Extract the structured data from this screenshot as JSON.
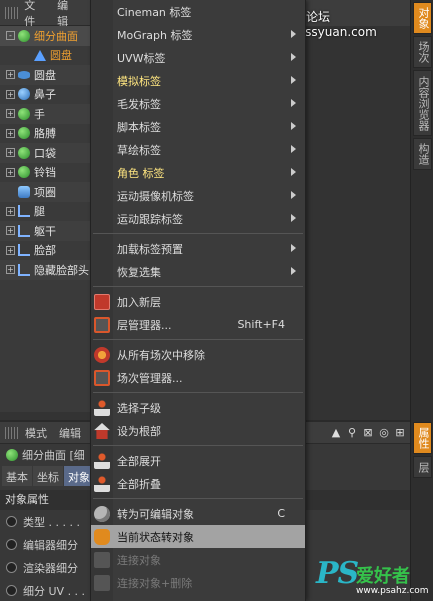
{
  "watermark_text": "思缘设计论坛 www.missyuan.com",
  "object_manager": {
    "menu": [
      "文件",
      "编辑"
    ],
    "items": [
      {
        "label": "细分曲面",
        "indent": 0,
        "icon": "subdivision-icon",
        "color": "orange",
        "expand": "-"
      },
      {
        "label": "圆盘",
        "indent": 1,
        "icon": "polygon-icon",
        "color": "orange",
        "expand": ""
      },
      {
        "label": "圆盘",
        "indent": 0,
        "icon": "disk-icon",
        "color": "normal",
        "expand": "+"
      },
      {
        "label": "鼻子",
        "indent": 0,
        "icon": "sphere-icon",
        "color": "normal",
        "expand": "+"
      },
      {
        "label": "手",
        "indent": 0,
        "icon": "sphere-icon",
        "color": "normal",
        "expand": "+"
      },
      {
        "label": "胳膊",
        "indent": 0,
        "icon": "sphere-icon",
        "color": "normal",
        "expand": "+"
      },
      {
        "label": "口袋",
        "indent": 0,
        "icon": "sphere-icon",
        "color": "normal",
        "expand": "+"
      },
      {
        "label": "铃铛",
        "indent": 0,
        "icon": "subdivision-icon",
        "color": "normal",
        "expand": "+"
      },
      {
        "label": "项圈",
        "indent": 0,
        "icon": "cylinder-icon",
        "color": "normal",
        "expand": ""
      },
      {
        "label": "腿",
        "indent": 0,
        "icon": "bone-icon",
        "color": "normal",
        "expand": "+"
      },
      {
        "label": "躯干",
        "indent": 0,
        "icon": "bone-icon",
        "color": "normal",
        "expand": "+"
      },
      {
        "label": "脸部",
        "indent": 0,
        "icon": "bone-icon",
        "color": "normal",
        "expand": "+"
      },
      {
        "label": "隐藏脸部头",
        "indent": 0,
        "icon": "bone-icon",
        "color": "normal",
        "expand": "+"
      }
    ]
  },
  "attribute_manager": {
    "menu": [
      "模式",
      "编辑"
    ],
    "title": "细分曲面 [细",
    "tabs": [
      "基本",
      "坐标",
      "对象"
    ],
    "active_tab": 2,
    "section": "对象属性",
    "rows": [
      "类型 . . . . .",
      "编辑器细分",
      "渲染器细分",
      "细分 UV . . ."
    ]
  },
  "right_tabs": [
    {
      "label": "对象",
      "active": true
    },
    {
      "label": "场次",
      "active": false
    },
    {
      "label": "内容浏览器",
      "active": false
    },
    {
      "label": "构造",
      "active": false
    },
    {
      "label": "属性",
      "active": true
    },
    {
      "label": "层",
      "active": false
    }
  ],
  "context_menu": {
    "groups": [
      [
        {
          "label": "Cineman 标签",
          "submenu": false,
          "style": "normal"
        },
        {
          "label": "MoGraph 标签",
          "submenu": true,
          "style": "normal"
        },
        {
          "label": "UVW标签",
          "submenu": true,
          "style": "normal"
        },
        {
          "label": "模拟标签",
          "submenu": true,
          "style": "yellow"
        },
        {
          "label": "毛发标签",
          "submenu": true,
          "style": "normal"
        },
        {
          "label": "脚本标签",
          "submenu": true,
          "style": "normal"
        },
        {
          "label": "草绘标签",
          "submenu": true,
          "style": "normal"
        },
        {
          "label": "角色 标签",
          "submenu": true,
          "style": "yellow"
        },
        {
          "label": "运动摄像机标签",
          "submenu": true,
          "style": "normal"
        },
        {
          "label": "运动跟踪标签",
          "submenu": true,
          "style": "normal"
        }
      ],
      [
        {
          "label": "加载标签预置",
          "submenu": true,
          "style": "normal"
        },
        {
          "label": "恢复选集",
          "submenu": true,
          "style": "normal"
        }
      ],
      [
        {
          "label": "加入新层",
          "icon": "new-layer-icon",
          "style": "normal"
        },
        {
          "label": "层管理器...",
          "icon": "layer-manager-icon",
          "shortcut": "Shift+F4",
          "style": "normal"
        }
      ],
      [
        {
          "label": "从所有场次中移除",
          "icon": "remove-take-icon",
          "style": "normal"
        },
        {
          "label": "场次管理器...",
          "icon": "take-manager-icon",
          "style": "normal"
        }
      ],
      [
        {
          "label": "选择子级",
          "icon": "select-children-icon",
          "style": "normal"
        },
        {
          "label": "设为根部",
          "icon": "set-root-icon",
          "style": "normal"
        }
      ],
      [
        {
          "label": "全部展开",
          "icon": "expand-all-icon",
          "style": "normal"
        },
        {
          "label": "全部折叠",
          "icon": "collapse-all-icon",
          "style": "normal"
        }
      ],
      [
        {
          "label": "转为可编辑对象",
          "icon": "make-editable-icon",
          "shortcut": "C",
          "style": "normal"
        },
        {
          "label": "当前状态转对象",
          "icon": "current-state-icon",
          "style": "highlight"
        },
        {
          "label": "连接对象",
          "icon": "connect-icon",
          "style": "disabled"
        },
        {
          "label": "连接对象+删除",
          "icon": "connect-delete-icon",
          "style": "disabled"
        }
      ]
    ]
  },
  "logo": {
    "mark": "PS",
    "cn": "爱好者",
    "url": "www.psahz.com"
  }
}
